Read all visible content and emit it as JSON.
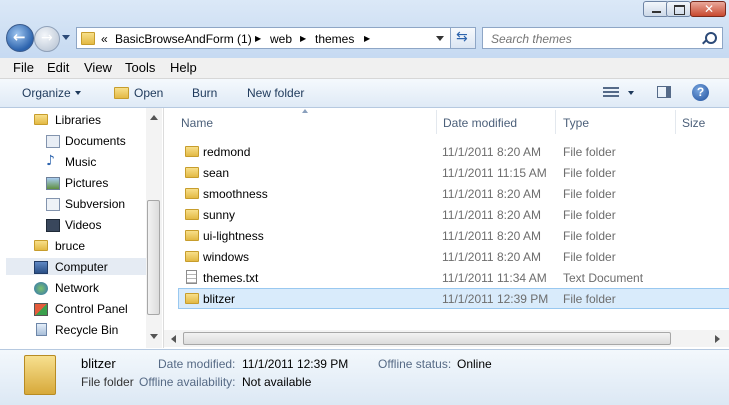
{
  "address": {
    "overflow": "«",
    "crumbs": [
      "BasicBrowseAndForm (1)",
      "web",
      "themes"
    ]
  },
  "search": {
    "placeholder": "Search themes"
  },
  "menu": {
    "items": [
      "File",
      "Edit",
      "View",
      "Tools",
      "Help"
    ]
  },
  "toolbar": {
    "organize": "Organize",
    "open": "Open",
    "burn": "Burn",
    "new_folder": "New folder"
  },
  "nav": {
    "items": [
      {
        "label": "Libraries",
        "icon": "libraries-icon"
      },
      {
        "label": "Documents",
        "icon": "documents-icon"
      },
      {
        "label": "Music",
        "icon": "music-icon"
      },
      {
        "label": "Pictures",
        "icon": "pictures-icon"
      },
      {
        "label": "Subversion",
        "icon": "subversion-icon"
      },
      {
        "label": "Videos",
        "icon": "videos-icon"
      },
      {
        "label": "bruce",
        "icon": "user-folder-icon"
      },
      {
        "label": "Computer",
        "icon": "computer-icon"
      },
      {
        "label": "Network",
        "icon": "network-icon"
      },
      {
        "label": "Control Panel",
        "icon": "control-panel-icon"
      },
      {
        "label": "Recycle Bin",
        "icon": "recycle-bin-icon"
      }
    ]
  },
  "columns": {
    "name": "Name",
    "date": "Date modified",
    "type": "Type",
    "size": "Size"
  },
  "files": [
    {
      "name": "redmond",
      "date": "11/1/2011 8:20 AM",
      "type": "File folder"
    },
    {
      "name": "sean",
      "date": "11/1/2011 11:15 AM",
      "type": "File folder"
    },
    {
      "name": "smoothness",
      "date": "11/1/2011 8:20 AM",
      "type": "File folder"
    },
    {
      "name": "sunny",
      "date": "11/1/2011 8:20 AM",
      "type": "File folder"
    },
    {
      "name": "ui-lightness",
      "date": "11/1/2011 8:20 AM",
      "type": "File folder"
    },
    {
      "name": "windows",
      "date": "11/1/2011 8:20 AM",
      "type": "File folder"
    },
    {
      "name": "themes.txt",
      "date": "11/1/2011 11:34 AM",
      "type": "Text Document"
    },
    {
      "name": "blitzer",
      "date": "11/1/2011 12:39 PM",
      "type": "File folder"
    }
  ],
  "details": {
    "name": "blitzer",
    "kind": "File folder",
    "date_label": "Date modified:",
    "date_value": "11/1/2011 12:39 PM",
    "offline_status_label": "Offline status:",
    "offline_status_value": "Online",
    "offline_avail_label": "Offline availability:",
    "offline_avail_value": "Not available"
  },
  "colors": {
    "selection": "#cce8ff",
    "accent": "#1e395b"
  }
}
